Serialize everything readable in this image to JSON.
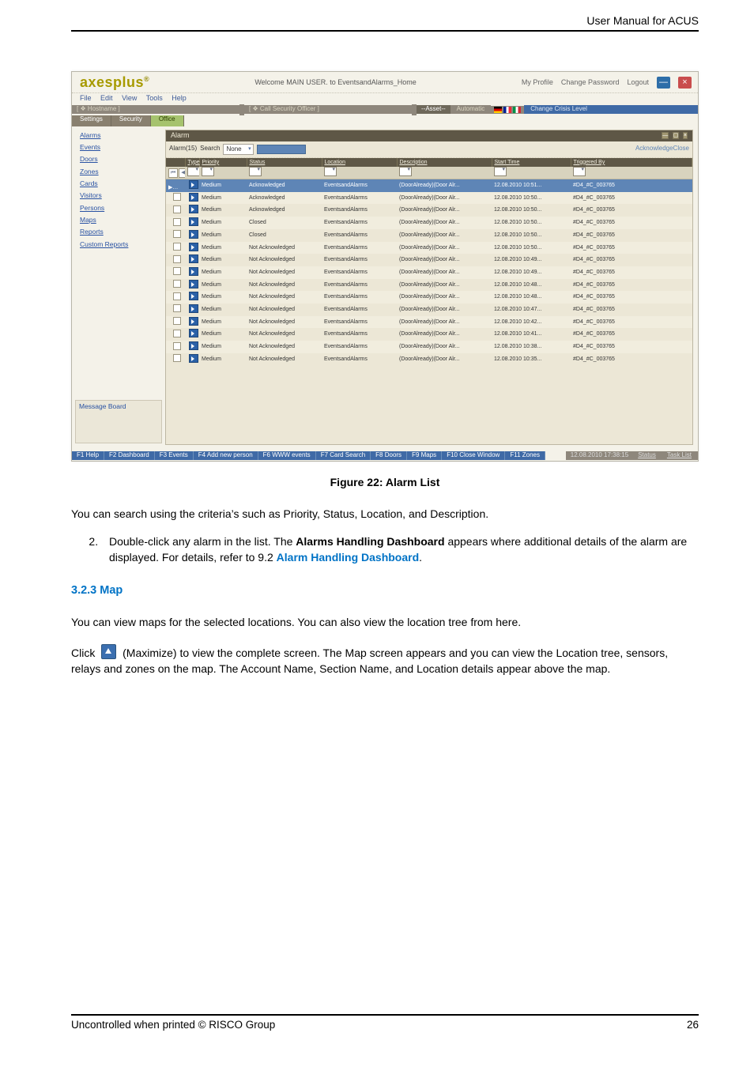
{
  "header_right": "User Manual for ACUS",
  "app": {
    "brand": "axesplus",
    "brand_sup": "®",
    "window_subtitle": "Welcome MAIN USER. to EventsandAlarms_Home",
    "top_links": {
      "my_profile": "My Profile",
      "change_password": "Change Password",
      "logout": "Logout"
    },
    "menu": {
      "file": "File",
      "edit": "Edit",
      "view": "View",
      "tools": "Tools",
      "help": "Help"
    },
    "status": {
      "host_caption": "[ ❖ Hostname        ]",
      "call_officer": "[ ❖ Call Security Officer ]",
      "asset_label": "--Asset--",
      "automatic": "Automatic",
      "endcap": "Change Crisis Level"
    },
    "pathbar": {
      "settings": "Settings",
      "security": "Security",
      "office": "Office"
    }
  },
  "sidebar": {
    "items": [
      {
        "label": "Alarms"
      },
      {
        "label": "Events"
      },
      {
        "label": "Doors"
      },
      {
        "label": "Zones"
      },
      {
        "label": "Cards"
      },
      {
        "label": "Visitors"
      },
      {
        "label": "Persons"
      },
      {
        "label": "Maps"
      },
      {
        "label": "Reports"
      },
      {
        "label": "Custom Reports"
      }
    ],
    "msgboard_title": "Message Board"
  },
  "main": {
    "pane_title": "Alarm",
    "filter": {
      "alarm_label": "Alarm(15)",
      "search_label": "Search",
      "search_value": "None"
    },
    "columns": {
      "c1": "",
      "c2": "Type",
      "c3": "Priority",
      "c4": "Status",
      "c5": "Location",
      "c6": "Description",
      "c7": "Start Time",
      "c8": "Triggered By"
    },
    "sel_row": {
      "priority": "Medium",
      "status": "Acknowledged",
      "location": "EventsandAlarms",
      "description": "(DoorAlready)(Door Alr...",
      "start": "12.08.2010 10:51...",
      "trig": "#D4_#C_003765"
    },
    "rows": [
      {
        "priority": "Medium",
        "status": "Acknowledged",
        "location": "EventsandAlarms",
        "description": "(DoorAlready)(Door Alr...",
        "start": "12.08.2010 10:50...",
        "trig": "#D4_#C_003765",
        "grey": false
      },
      {
        "priority": "Medium",
        "status": "Acknowledged",
        "location": "EventsandAlarms",
        "description": "(DoorAlready)(Door Alr...",
        "start": "12.08.2010 10:50...",
        "trig": "#D4_#C_003765",
        "grey": false
      },
      {
        "priority": "Medium",
        "status": "Closed",
        "location": "EventsandAlarms",
        "description": "(DoorAlready)(Door Alr...",
        "start": "12.08.2010 10:50...",
        "trig": "#D4_#C_003765",
        "grey": true
      },
      {
        "priority": "Medium",
        "status": "Closed",
        "location": "EventsandAlarms",
        "description": "(DoorAlready)(Door Alr...",
        "start": "12.08.2010 10:50...",
        "trig": "#D4_#C_003765",
        "grey": false
      },
      {
        "priority": "Medium",
        "status": "Not Acknowledged",
        "location": "EventsandAlarms",
        "description": "(DoorAlready)(Door Alr...",
        "start": "12.08.2010 10:50...",
        "trig": "#D4_#C_003765",
        "grey": true
      },
      {
        "priority": "Medium",
        "status": "Not Acknowledged",
        "location": "EventsandAlarms",
        "description": "(DoorAlready)(Door Alr...",
        "start": "12.08.2010 10:49...",
        "trig": "#D4_#C_003765",
        "grey": false
      },
      {
        "priority": "Medium",
        "status": "Not Acknowledged",
        "location": "EventsandAlarms",
        "description": "(DoorAlready)(Door Alr...",
        "start": "12.08.2010 10:49...",
        "trig": "#D4_#C_003765",
        "grey": true
      },
      {
        "priority": "Medium",
        "status": "Not Acknowledged",
        "location": "EventsandAlarms",
        "description": "(DoorAlready)(Door Alr...",
        "start": "12.08.2010 10:48...",
        "trig": "#D4_#C_003765",
        "grey": false
      },
      {
        "priority": "Medium",
        "status": "Not Acknowledged",
        "location": "EventsandAlarms",
        "description": "(DoorAlready)(Door Alr...",
        "start": "12.08.2010 10:48...",
        "trig": "#D4_#C_003765",
        "grey": true
      },
      {
        "priority": "Medium",
        "status": "Not Acknowledged",
        "location": "EventsandAlarms",
        "description": "(DoorAlready)(Door Alr...",
        "start": "12.08.2010 10:47...",
        "trig": "#D4_#C_003765",
        "grey": false
      },
      {
        "priority": "Medium",
        "status": "Not Acknowledged",
        "location": "EventsandAlarms",
        "description": "(DoorAlready)(Door Alr...",
        "start": "12.08.2010 10:42...",
        "trig": "#D4_#C_003765",
        "grey": true
      },
      {
        "priority": "Medium",
        "status": "Not Acknowledged",
        "location": "EventsandAlarms",
        "description": "(DoorAlready)(Door Alr...",
        "start": "12.08.2010 10:41...",
        "trig": "#D4_#C_003765",
        "grey": false
      },
      {
        "priority": "Medium",
        "status": "Not Acknowledged",
        "location": "EventsandAlarms",
        "description": "(DoorAlready)(Door Alr...",
        "start": "12.08.2010 10:38...",
        "trig": "#D4_#C_003765",
        "grey": true
      },
      {
        "priority": "Medium",
        "status": "Not Acknowledged",
        "location": "EventsandAlarms",
        "description": "(DoorAlready)(Door Alr...",
        "start": "12.08.2010 10:35...",
        "trig": "#D4_#C_003765",
        "grey": false
      }
    ]
  },
  "bottombar": {
    "f1": "F1 Help",
    "f2": "F2 Dashboard",
    "f3": "F3 Events",
    "f4": "F4 Add new person",
    "f6": "F6 WWW events",
    "f7": "F7 Card Search",
    "f8": "F8 Doors",
    "f9": "F9 Maps",
    "f10": "F10 Close Window",
    "f11": "F11 Zones",
    "clock": "12.08.2010   17:38:15",
    "status": "Status",
    "tasklist": "Task List"
  },
  "caption": "Figure 22: Alarm List",
  "para1": "You can search using the criteria’s such as Priority, Status, Location, and Description.",
  "list_item": {
    "num": "2.",
    "pre": "Double-click any alarm in the list. The ",
    "bold1": "Alarms Handling Dashboard",
    "mid": " appears where additional details of the alarm are displayed. For details, refer to 9.2 ",
    "link": "Alarm Handling Dashboard",
    "end": "."
  },
  "sec323": "3.2.3  Map",
  "map_p1": "You can view maps for the selected locations. You can also view the location tree from here.",
  "map_p2a": "Click ",
  "map_p2b": " (Maximize) to view the complete screen. The Map screen appears and you can view the Location tree, sensors, relays and zones on the map. The Account Name, Section Name, and Location details appear above the map.",
  "footer_left": "Uncontrolled when printed © RISCO Group",
  "footer_right": "26"
}
